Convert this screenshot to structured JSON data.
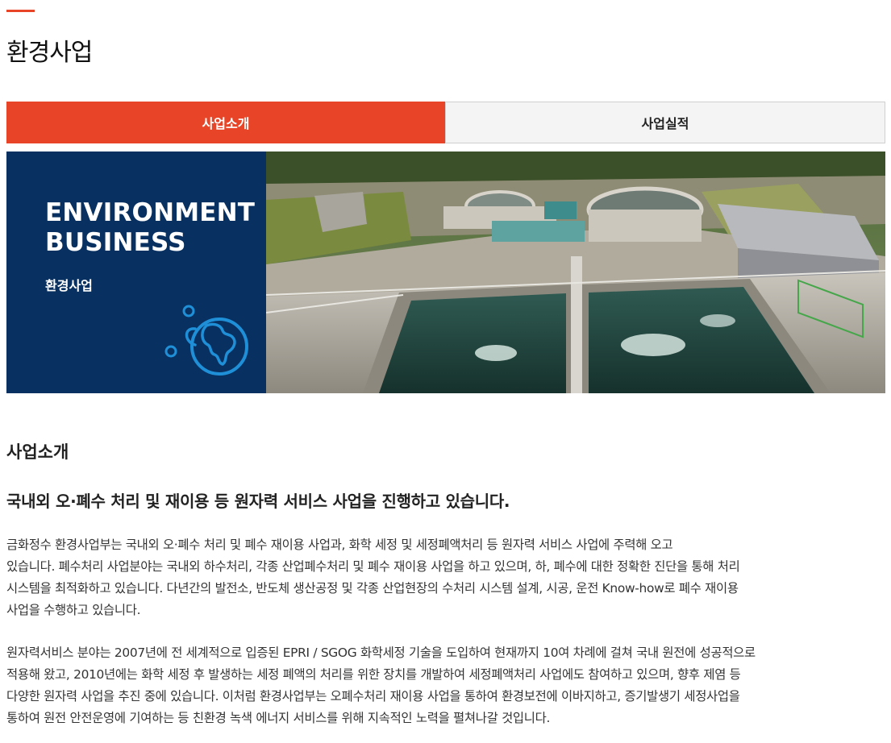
{
  "page": {
    "title": "환경사업"
  },
  "tabs": [
    {
      "label": "사업소개",
      "active": true
    },
    {
      "label": "사업실적",
      "active": false
    }
  ],
  "banner": {
    "title_line1": "ENVIRONMENT",
    "title_line2": "BUSINESS",
    "subtitle": "환경사업",
    "icon": "globe-leaf-icon",
    "photo": "water-treatment-plant-photo"
  },
  "content": {
    "heading": "사업소개",
    "subheading": "국내외 오·폐수 처리 및 재이용 등 원자력 서비스 사업을 진행하고 있습니다.",
    "paragraph1_line1": "금화정수 환경사업부는 국내외 오·폐수 처리 및 폐수 재이용 사업과, 화학 세정 및 세정폐액처리 등 원자력 서비스 사업에 주력해 오고",
    "paragraph1_line2": "있습니다. 폐수처리 사업분야는 국내외 하수처리, 각종 산업폐수처리 및 폐수 재이용 사업을 하고 있으며, 하, 폐수에 대한 정확한 진단을 통해 처리",
    "paragraph1_line3": "시스템을 최적화하고 있습니다. 다년간의 발전소, 반도체 생산공정 및 각종 산업현장의 수처리 시스템 설계, 시공, 운전 Know-how로 폐수 재이용",
    "paragraph1_line4": "사업을 수행하고 있습니다.",
    "paragraph2_line1": "원자력서비스 분야는 2007년에 전 세계적으로 입증된 EPRI / SGOG 화학세정 기술을 도입하여 현재까지 10여 차례에 걸쳐 국내 원전에 성공적으로",
    "paragraph2_line2": "적용해 왔고, 2010년에는 화학 세정 후 발생하는 세정 폐액의 처리를 위한 장치를 개발하여 세정폐액처리 사업에도 참여하고 있으며, 향후 제염 등",
    "paragraph2_line3": "다양한 원자력 사업을 추진 중에 있습니다. 이처럼 환경사업부는 오폐수처리 재이용 사업을 통하여 환경보전에 이바지하고, 증기발생기 세정사업을",
    "paragraph2_line4": "통하여 원전 안전운영에 기여하는 등 친환경 녹색 에너지 서비스를 위해 지속적인 노력을 펼쳐나갈 것입니다."
  },
  "colors": {
    "accent": "#e84427",
    "banner_navy": "#083060",
    "icon_blue": "#1f8fd8"
  }
}
